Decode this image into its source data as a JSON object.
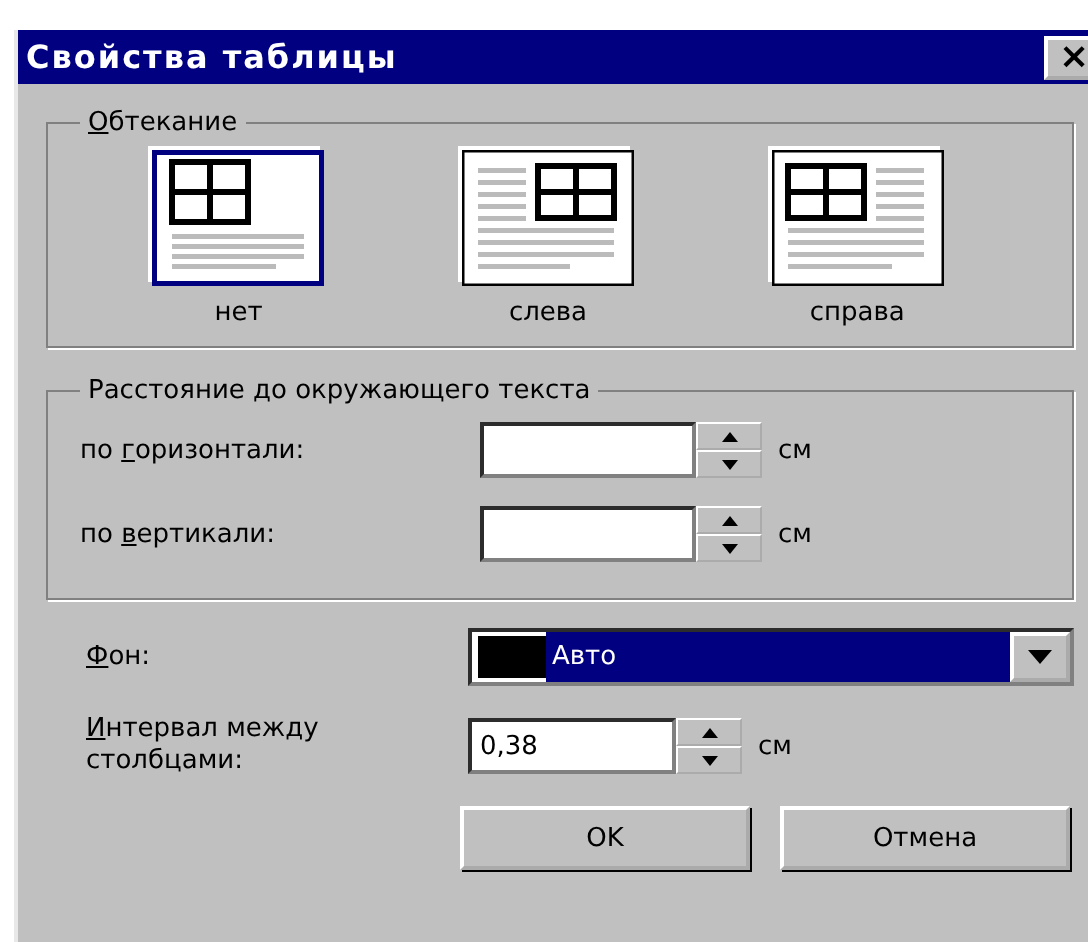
{
  "window": {
    "title": "Свойства таблицы",
    "close": "×"
  },
  "wrapping": {
    "legend": {
      "key": "О",
      "rest": "бтекание"
    },
    "options": [
      {
        "label": "нет",
        "kind": "none",
        "selected": true
      },
      {
        "label": "слева",
        "kind": "left",
        "selected": false
      },
      {
        "label": "справа",
        "kind": "right",
        "selected": false
      }
    ]
  },
  "distance": {
    "legend": "Расстояние до окружающего текста",
    "fields": [
      {
        "label": {
          "pre": "по ",
          "key": "г",
          "rest": "оризонтали:"
        },
        "unit": "см"
      },
      {
        "label": {
          "pre": "по ",
          "key": "в",
          "rest": "ертикали:"
        },
        "unit": "см"
      }
    ]
  },
  "background": {
    "label": {
      "key": "Ф",
      "rest": "он:"
    },
    "value": "Авто"
  },
  "spacing": {
    "label": {
      "key": "И",
      "rest": "нтервал между столбцами:"
    },
    "value": "0,38",
    "unit": "см"
  },
  "buttons": [
    "OK",
    "Отмена"
  ]
}
